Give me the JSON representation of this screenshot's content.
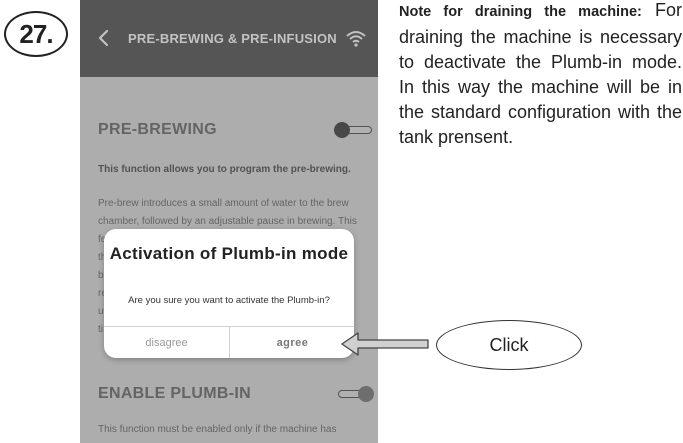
{
  "step": {
    "number": "27."
  },
  "app_bar": {
    "title": "PRE-BREWING & PRE-INFUSION"
  },
  "pre_brewing": {
    "title": "PRE-BREWING",
    "toggle_state": "off",
    "description_bold": "This function allows you to program the pre-brewing.",
    "description_lines": [
      "Pre-brew introduces a small amount of water to the brew",
      "chamber, followed by an adjustable pause in brewing. This",
      "fe",
      "th",
      "b",
      "re",
      "u",
      "ti"
    ]
  },
  "dialog": {
    "title": "Activation of Plumb-in mode",
    "message": "Are you sure you want to activate the Plumb-in?",
    "disagree_label": "disagree",
    "agree_label": "agree"
  },
  "plumb_in": {
    "title": "ENABLE PLUMB-IN",
    "toggle_state": "on",
    "description": "This function must be enabled only if the machine has"
  },
  "note": {
    "title": "Note for draining the machine:",
    "body": "For draining the machine is necessary to deactivate the Plumb-in mode. In this way the machine will be in the standard configuration with the tank prensent."
  },
  "callout": {
    "label": "Click"
  },
  "colors": {
    "app_bar": "#3a3a3a",
    "screen_bg": "#d9d9d9",
    "dialog_bg": "#ffffff",
    "toggle_knob": "#666666"
  }
}
